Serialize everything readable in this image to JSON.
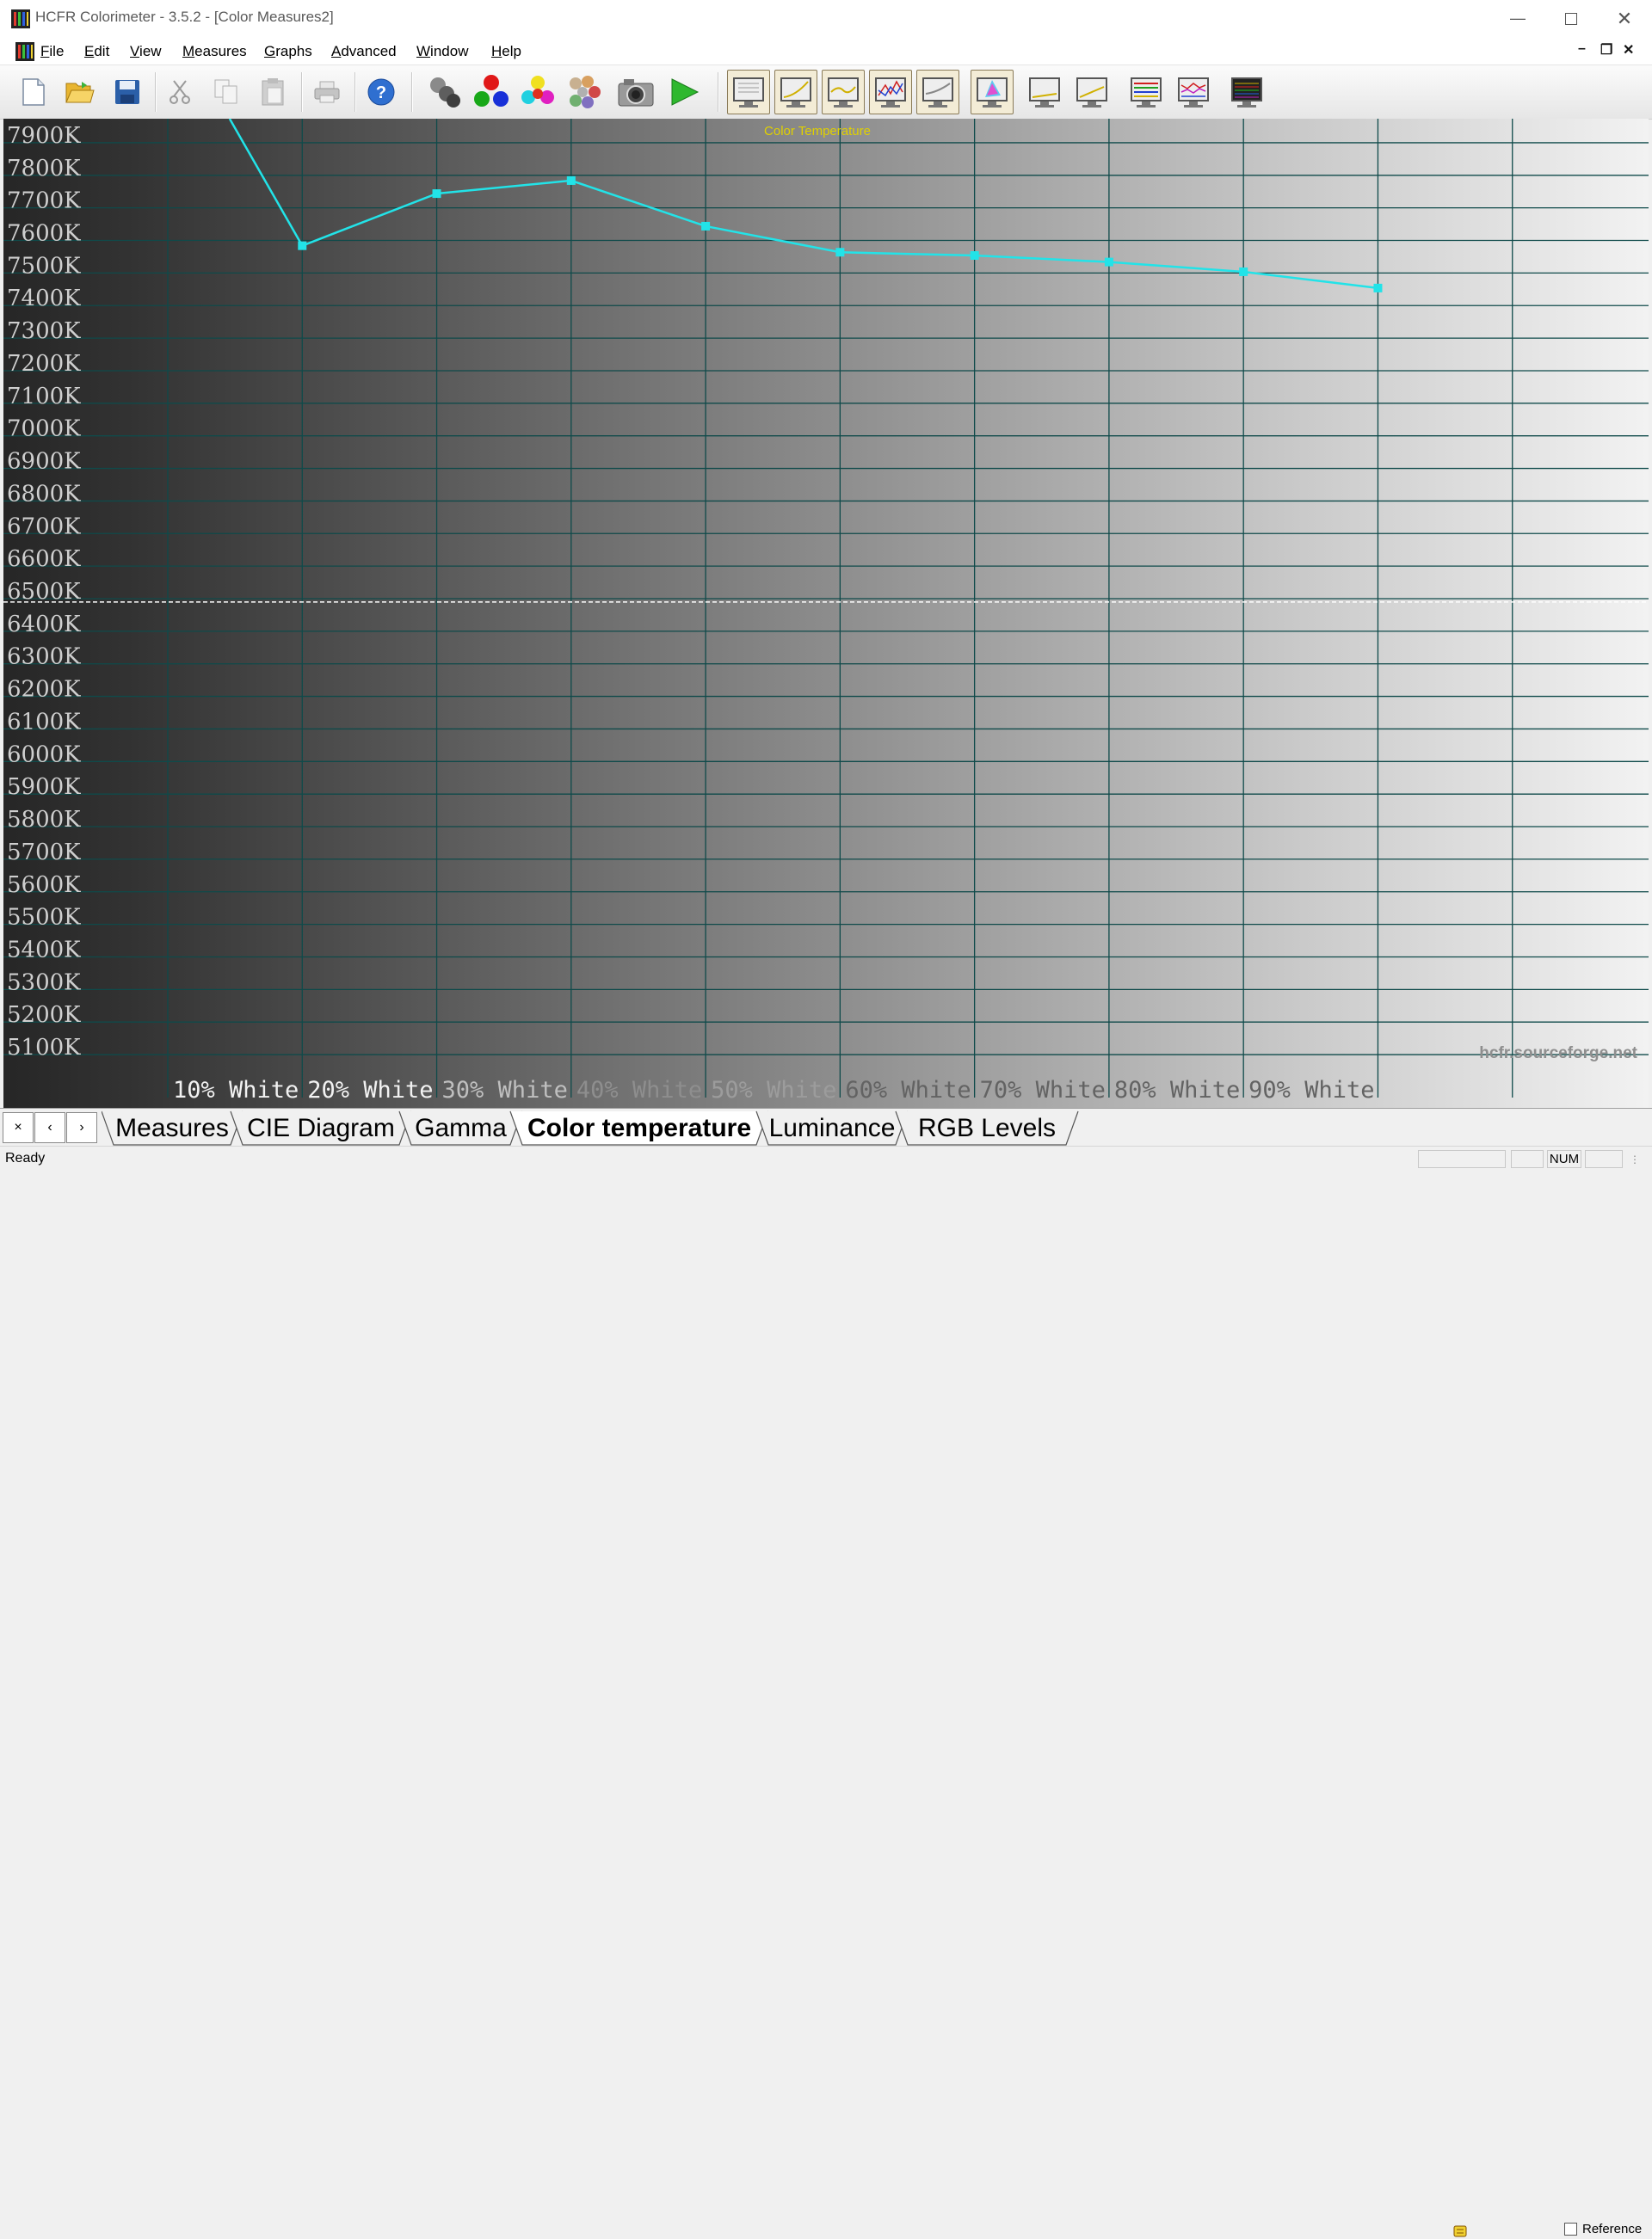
{
  "window": {
    "title": "HCFR Colorimeter - 3.5.2 - [Color Measures2]",
    "controls": [
      "minimize",
      "maximize",
      "close"
    ]
  },
  "menu": {
    "items": [
      {
        "id": "file",
        "accel": "F",
        "rest": "ile"
      },
      {
        "id": "edit",
        "accel": "E",
        "rest": "dit"
      },
      {
        "id": "view",
        "accel": "V",
        "rest": "iew"
      },
      {
        "id": "measures",
        "accel": "M",
        "rest": "easures"
      },
      {
        "id": "graphs",
        "accel": "G",
        "rest": "raphs"
      },
      {
        "id": "advanced",
        "accel": "A",
        "rest": "dvanced"
      },
      {
        "id": "window",
        "accel": "W",
        "rest": "indow"
      },
      {
        "id": "help",
        "accel": "H",
        "rest": "elp"
      }
    ]
  },
  "toolbar": {
    "buttons": [
      "new-icon",
      "open-icon",
      "save-icon",
      "cut-icon",
      "copy-icon",
      "paste-icon",
      "print-icon",
      "help-icon",
      "sensor-icon",
      "primaries-icon",
      "secondaries-icon",
      "colors-icon",
      "camera-icon",
      "play-icon",
      "graph-view-1-icon",
      "graph-view-2-icon",
      "graph-view-3-icon",
      "graph-view-4-icon",
      "graph-view-5-icon",
      "cie-view-icon",
      "graph-view-6-icon",
      "graph-view-7-icon",
      "rgb-levels-icon",
      "multi-graph-icon",
      "monitor-icon"
    ]
  },
  "chart_data": {
    "type": "line",
    "title": "Color Temperature",
    "categories": [
      "10% White",
      "20% White",
      "30% White",
      "40% White",
      "50% White",
      "60% White",
      "70% White",
      "80% White",
      "90% White"
    ],
    "series": [
      {
        "x": [
          20,
          30,
          40,
          50,
          60,
          70,
          80,
          90,
          100
        ],
        "values": [
          7560,
          7720,
          7760,
          7620,
          7540,
          7530,
          7510,
          7480,
          7430
        ]
      }
    ],
    "ylim": [
      5050,
      7950
    ],
    "yticks": [
      5100,
      5200,
      5300,
      5400,
      5500,
      5600,
      5700,
      5800,
      5900,
      6000,
      6100,
      6200,
      6300,
      6400,
      6500,
      6600,
      6700,
      6800,
      6900,
      7000,
      7100,
      7200,
      7300,
      7400,
      7500,
      7600,
      7700,
      7800,
      7900
    ],
    "ytick_unit": "K",
    "reference": 6450,
    "watermark": "hcfr.sourceforge.net",
    "line_color": "#22e3e8",
    "title_color": "#e0d000",
    "grid_color": "#0f4a4a"
  },
  "tabs": {
    "items": [
      "Measures",
      "CIE Diagram",
      "Gamma",
      "Color temperature",
      "Luminance",
      "RGB Levels"
    ],
    "active": "Color temperature",
    "nav": [
      "×",
      "‹",
      "›"
    ]
  },
  "reference_checkbox": {
    "label": "Reference",
    "checked": false
  },
  "status": {
    "text": "Ready",
    "num": "NUM"
  }
}
